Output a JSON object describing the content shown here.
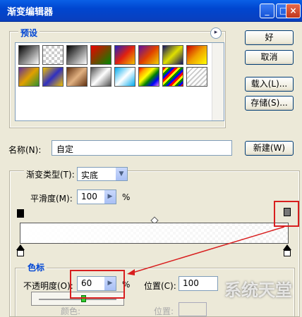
{
  "window": {
    "title": "渐变编辑器",
    "minimize": "_",
    "maximize": "□",
    "close": "×"
  },
  "presets": {
    "legend": "预设",
    "menu_glyph": "▸",
    "swatches": [
      "linear-gradient(135deg,#000,#fff)",
      "repeating-conic-gradient(#ccc 0% 25%, #fff 0% 50%)",
      "linear-gradient(135deg,#000,#fff)",
      "linear-gradient(135deg,#e00,#080)",
      "linear-gradient(135deg,#2020c0,#e02010,#f0c000)",
      "linear-gradient(135deg,#6010a0,#e04000,#f0d000)",
      "linear-gradient(135deg,#101060,#e0e000,#101060)",
      "linear-gradient(135deg,#c00,#f0a000,#ff0)",
      "linear-gradient(135deg,#60309a,#e0a000,#309030)",
      "linear-gradient(135deg,#f0c000,#3030c0,#f0c000)",
      "linear-gradient(135deg,#603010,#e0b080,#603010)",
      "linear-gradient(135deg,#505050,#fff,#505050)",
      "linear-gradient(135deg,#0ae,#fff,#0ae)",
      "linear-gradient(135deg,red,orange,yellow,green,blue,violet)",
      "repeating-linear-gradient(135deg,red 0 3px,yellow 3px 6px,green 6px 9px,blue 9px 12px)",
      "repeating-linear-gradient(135deg,#ccc 0 2px,#fff 2px 5px)"
    ]
  },
  "buttons": {
    "ok": "好",
    "cancel": "取消",
    "load": "载入(L)...",
    "save": "存储(S)...",
    "new": "新建(W)"
  },
  "name": {
    "label": "名称(N):",
    "value": "自定"
  },
  "gradient": {
    "type_label": "渐变类型(T):",
    "type_value": "实底",
    "smoothness_label": "平滑度(M):",
    "smoothness_value": "100",
    "percent": "%"
  },
  "stops": {
    "legend": "色标",
    "opacity_label": "不透明度(O):",
    "opacity_value": "60",
    "percent": "%",
    "position_label": "位置(C):",
    "position_value": "100",
    "color_label": "颜色:",
    "position2_label": "位置:"
  },
  "watermark": "系统天堂"
}
